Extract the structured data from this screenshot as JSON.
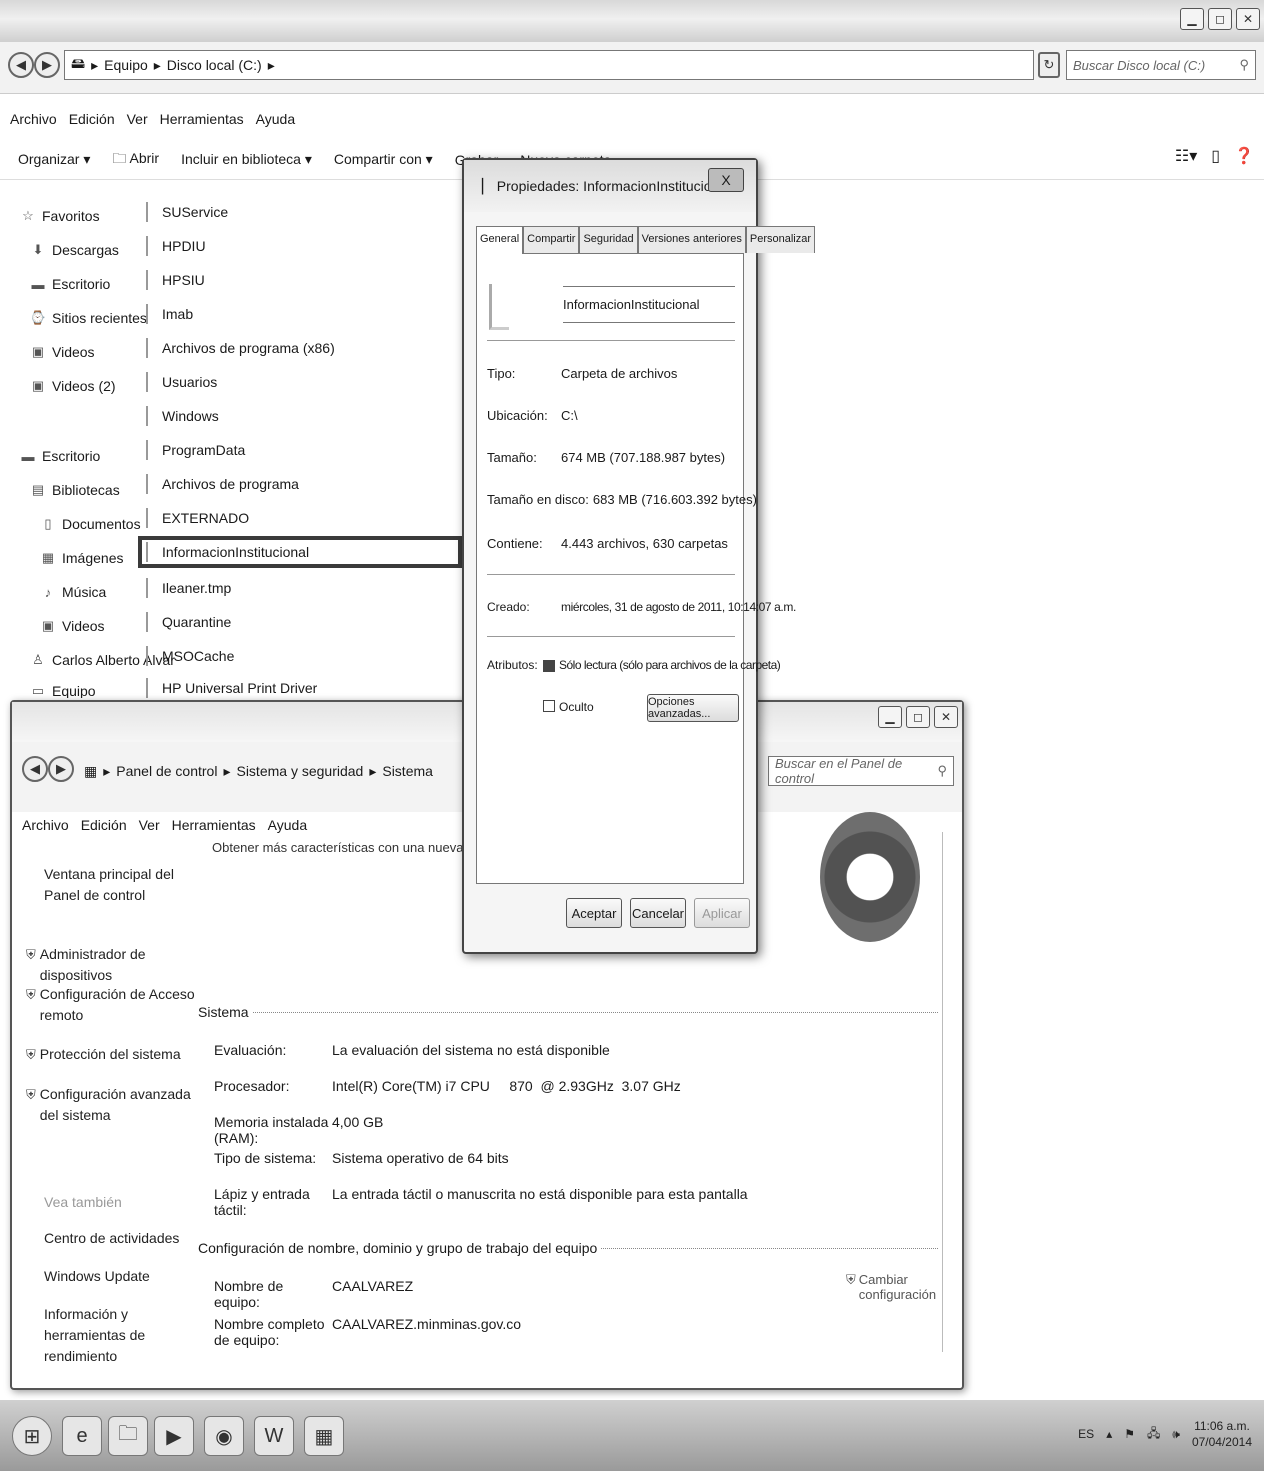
{
  "explorer": {
    "breadcrumb": [
      "Equipo",
      "Disco local (C:)"
    ],
    "search_placeholder": "Buscar Disco local (C:)",
    "menu": [
      "Archivo",
      "Edición",
      "Ver",
      "Herramientas",
      "Ayuda"
    ],
    "toolbar": {
      "organize": "Organizar ▾",
      "open": "Abrir",
      "include": "Incluir en biblioteca ▾",
      "share": "Compartir con ▾",
      "burn": "Grabar",
      "new_folder": "Nueva carpeta"
    },
    "nav": {
      "favorites": "Favoritos",
      "fav_items": [
        "Descargas",
        "Escritorio",
        "Sitios recientes",
        "Videos",
        "Videos (2)"
      ],
      "desktop": "Escritorio",
      "libraries": "Bibliotecas",
      "lib_items": [
        "Documentos",
        "Imágenes",
        "Música",
        "Videos"
      ],
      "user": "Carlos Alberto Alvar",
      "computer": "Equipo"
    },
    "files": [
      "SUService",
      "HPDIU",
      "HPSIU",
      "Imab",
      "Archivos de programa (x86)",
      "Usuarios",
      "Windows",
      "ProgramData",
      "Archivos de programa",
      "EXTERNADO",
      "InformacionInstitucional",
      "Ileaner.tmp",
      "Quarantine",
      "MSOCache",
      "HP Universal Print Driver"
    ]
  },
  "control_panel": {
    "breadcrumb": [
      "Panel de control",
      "Sistema y seguridad",
      "Sistema"
    ],
    "search_placeholder": "Buscar en el Panel de control",
    "menu": [
      "Archivo",
      "Edición",
      "Ver",
      "Herramientas",
      "Ayuda"
    ],
    "left_links": {
      "home": "Ventana principal del Panel de control",
      "device_manager": "Administrador de dispositivos",
      "remote": "Configuración de Acceso remoto",
      "protection": "Protección del sistema",
      "advanced": "Configuración avanzada del sistema",
      "see_also": "Vea también",
      "action_center": "Centro de actividades",
      "windows_update": "Windows Update",
      "perf": "Información y herramientas de rendimiento"
    },
    "upgrade_text": "Obtener más características con una nueva edición de Windo",
    "system_section": "Sistema",
    "system_rows": [
      {
        "k": "Evaluación:",
        "v": "La evaluación del sistema no está disponible"
      },
      {
        "k": "Procesador:",
        "v": "Intel(R) Core(TM) i7 CPU     870  @ 2.93GHz  3.07 GHz"
      },
      {
        "k": "Memoria instalada (RAM):",
        "v": "4,00 GB"
      },
      {
        "k": "Tipo de sistema:",
        "v": "Sistema operativo de 64 bits"
      },
      {
        "k": "Lápiz y entrada táctil:",
        "v": "La entrada táctil o manuscrita no está disponible para esta pantalla"
      }
    ],
    "name_section": "Configuración de nombre, dominio y grupo de trabajo del equipo",
    "name_rows": [
      {
        "k": "Nombre de equipo:",
        "v": "CAALVAREZ"
      },
      {
        "k": "Nombre completo de equipo:",
        "v": "CAALVAREZ.minminas.gov.co"
      }
    ],
    "change_settings": "Cambiar configuración"
  },
  "properties": {
    "title": "Propiedades: InformacionInstitucional",
    "close": "X",
    "tabs": [
      "General",
      "Compartir",
      "Seguridad",
      "Versiones anteriores",
      "Personalizar"
    ],
    "folder_name": "InformacionInstitucional",
    "rows": [
      {
        "k": "Tipo:",
        "v": "Carpeta de archivos"
      },
      {
        "k": "Ubicación:",
        "v": "C:\\"
      },
      {
        "k": "Tamaño:",
        "v": "674 MB (707.188.987 bytes)"
      },
      {
        "k": "Tamaño en disco:",
        "v": "683 MB (716.603.392 bytes)"
      },
      {
        "k": "Contiene:",
        "v": "4.443 archivos, 630 carpetas"
      }
    ],
    "created_label": "Creado:",
    "created_value": "miércoles, 31 de agosto de 2011, 10:14:07 a.m.",
    "attributes_label": "Atributos:",
    "readonly_label": "Sólo lectura (sólo para archivos de la carpeta)",
    "hidden_label": "Oculto",
    "advanced_button": "Opciones avanzadas...",
    "ok": "Aceptar",
    "cancel": "Cancelar",
    "apply": "Aplicar"
  },
  "taskbar": {
    "lang": "ES",
    "time": "11:06 a.m.",
    "date": "07/04/2014"
  }
}
